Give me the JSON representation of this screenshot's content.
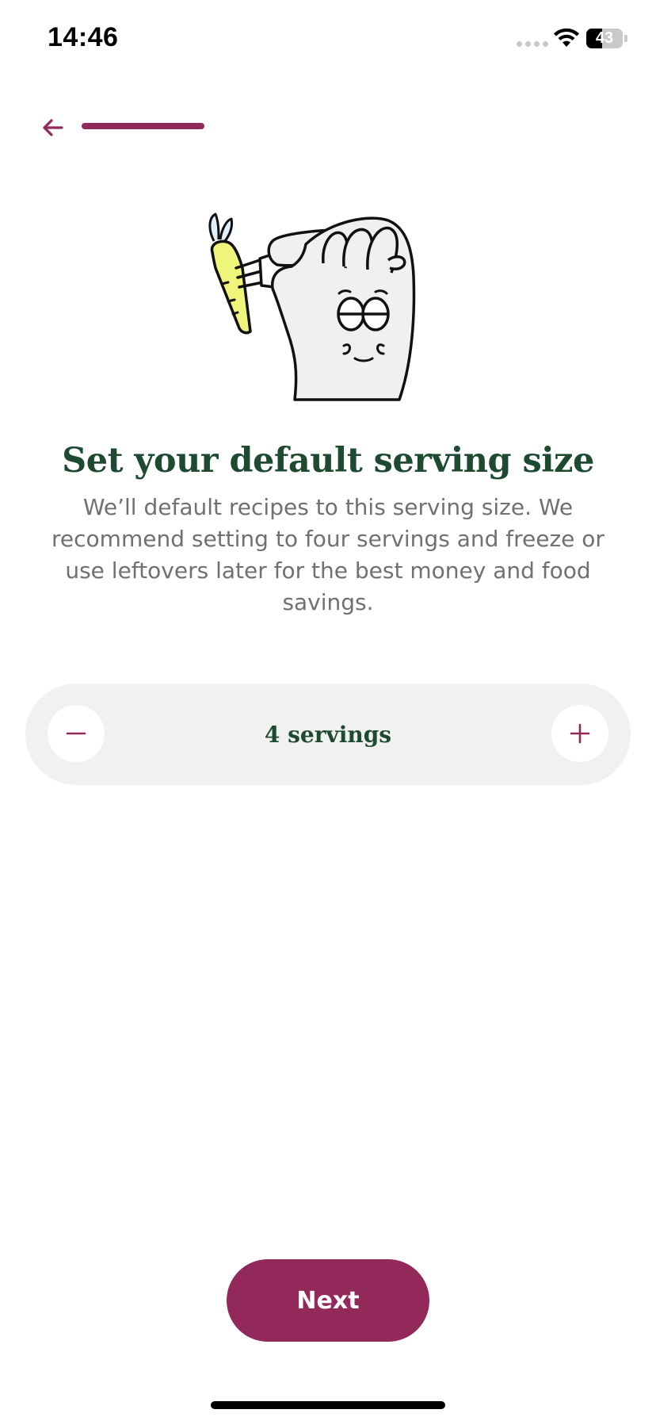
{
  "status_bar": {
    "time": "14:46",
    "battery_level": 43,
    "battery_label": "43",
    "icons": [
      "signal-dots-icon",
      "wifi-icon",
      "battery-icon"
    ]
  },
  "nav": {
    "back_icon": "arrow-left-icon",
    "progress_fraction": 0.5
  },
  "illustration": {
    "icon": "hand-holding-fork-with-carrot-illustration"
  },
  "header": {
    "title": "Set your default serving size",
    "subtitle": "We’ll default recipes to this serving size. We recommend setting to four servings and freeze or use leftovers later for the best money and food savings."
  },
  "stepper": {
    "value_label": "4 servings",
    "servings": 4,
    "minus_icon": "minus-icon",
    "plus_icon": "plus-icon"
  },
  "footer": {
    "next_label": "Next"
  },
  "colors": {
    "accent": "#912a5a",
    "button": "#93285b",
    "title": "#1d4a31",
    "subtitle": "#707070",
    "stepper_bg": "#f2f1f1"
  }
}
